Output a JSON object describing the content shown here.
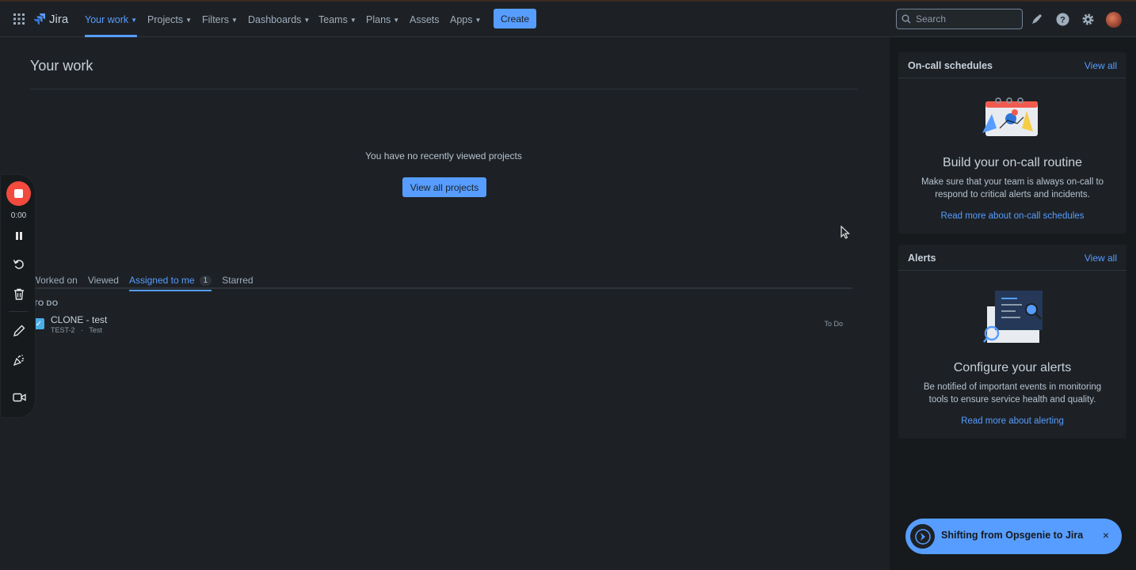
{
  "app": {
    "name": "Jira"
  },
  "nav": {
    "items": [
      {
        "label": "Your work",
        "dropdown": true,
        "active": true
      },
      {
        "label": "Projects",
        "dropdown": true
      },
      {
        "label": "Filters",
        "dropdown": true
      },
      {
        "label": "Dashboards",
        "dropdown": true
      },
      {
        "label": "Teams",
        "dropdown": true
      },
      {
        "label": "Plans",
        "dropdown": true
      },
      {
        "label": "Assets",
        "dropdown": false
      },
      {
        "label": "Apps",
        "dropdown": true
      }
    ],
    "create_label": "Create",
    "search_placeholder": "Search",
    "icons": [
      "apps-grid-icon",
      "notifications-icon",
      "help-icon",
      "settings-icon",
      "avatar"
    ]
  },
  "main": {
    "title": "Your work",
    "empty_projects_text": "You have no recently viewed projects",
    "view_all_projects_label": "View all projects",
    "tabs": [
      {
        "label": "Worked on"
      },
      {
        "label": "Viewed"
      },
      {
        "label": "Assigned to me",
        "count": "1",
        "active": true
      },
      {
        "label": "Starred"
      }
    ],
    "group_label": "TO DO",
    "issues": [
      {
        "title": "CLONE - test",
        "key": "TEST-2",
        "project": "Test",
        "separator": "·",
        "status": "To Do"
      }
    ]
  },
  "recorder": {
    "time": "0:00",
    "icons": [
      "stop-icon",
      "pause-icon",
      "restart-icon",
      "trash-icon",
      "pen-icon",
      "effects-icon",
      "camera-icon"
    ]
  },
  "sidebar": {
    "oncall": {
      "title": "On-call schedules",
      "view_all": "View all",
      "heading": "Build your on-call routine",
      "desc": "Make sure that your team is always on-call to respond to critical alerts and incidents.",
      "link": "Read more about on-call schedules"
    },
    "alerts": {
      "title": "Alerts",
      "view_all": "View all",
      "heading": "Configure your alerts",
      "desc": "Be notified of important events in monitoring tools to ensure service health and quality.",
      "link": "Read more about alerting"
    }
  },
  "toast": {
    "text": "Shifting from Opsgenie to Jira",
    "close": "×"
  },
  "colors": {
    "accent": "#579dff",
    "background": "#1d2125",
    "sidebar": "#161a1d",
    "record": "#f24a3d"
  }
}
